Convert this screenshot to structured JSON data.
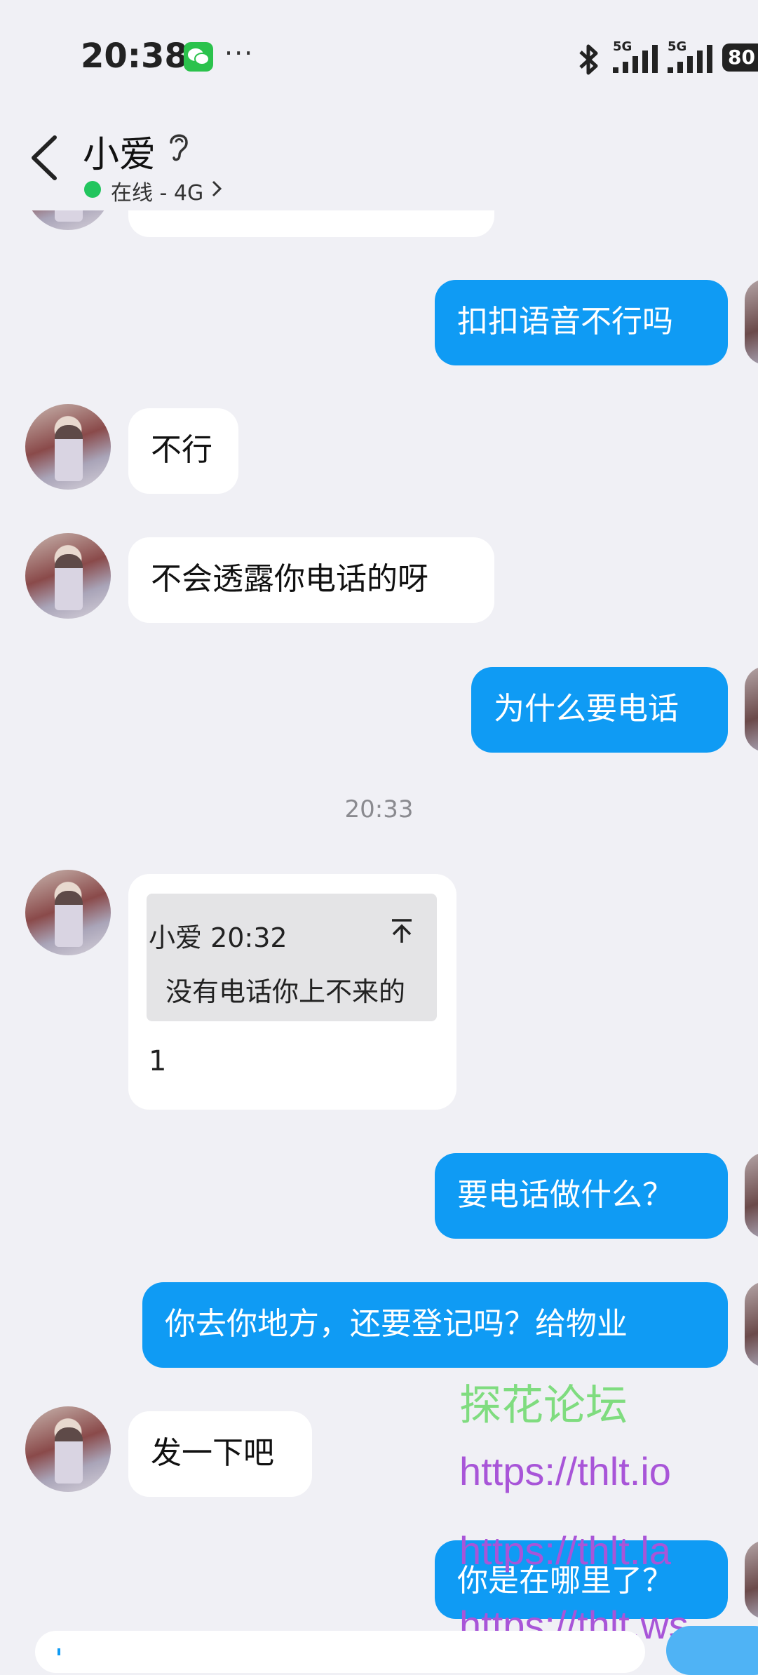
{
  "status_bar": {
    "time": "20:38",
    "dots": "···",
    "signal_1": "5G",
    "signal_2": "5G",
    "battery": "80"
  },
  "header": {
    "title": "小爱",
    "status": "在线 - 4G"
  },
  "messages": [
    {
      "side": "out",
      "text": "扣扣语音不行吗"
    },
    {
      "side": "in",
      "text": "不行"
    },
    {
      "side": "in",
      "text": "不会透露你电话的呀"
    },
    {
      "side": "out",
      "text": "为什么要电话"
    },
    {
      "side": "time",
      "text": "20:33"
    },
    {
      "side": "in",
      "quote_header": "小爱 20:32",
      "quote_text": "没有电话你上不来的",
      "text": "1"
    },
    {
      "side": "out",
      "text": "要电话做什么？"
    },
    {
      "side": "out",
      "text": "你去你地方，还要登记吗？给物业"
    },
    {
      "side": "in",
      "text": "发一下吧"
    },
    {
      "side": "out",
      "text": "你是在哪里了？"
    }
  ],
  "watermark": {
    "title": "探花论坛",
    "urls": [
      "https://thlt.io",
      "https://thlt.la",
      "https://thlt.ws"
    ]
  },
  "colors": {
    "outgoing_bubble": "#0f9bf4",
    "incoming_bubble": "#ffffff",
    "background": "#f0f0f5",
    "online": "#22c55e"
  }
}
